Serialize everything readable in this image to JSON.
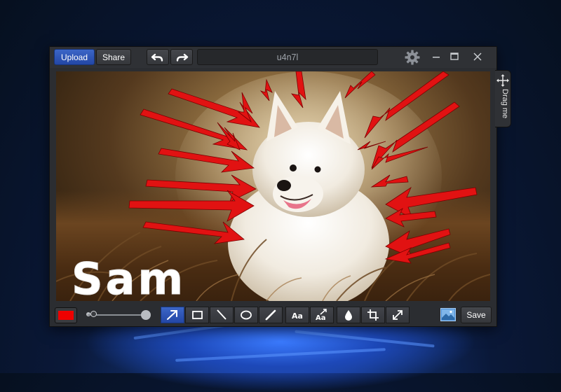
{
  "titlebar": {
    "upload_label": "Upload",
    "share_label": "Share",
    "title_value": "u4n7l"
  },
  "drag_tab": {
    "label": "Drag me"
  },
  "toolbar": {
    "current_color": "#ee0000",
    "save_label": "Save",
    "active_tool": "arrow-tool"
  },
  "canvas": {
    "annotation_text": "Sam",
    "arrow_color": "#e11212"
  },
  "icons": [
    "undo-icon",
    "redo-icon",
    "gear-icon",
    "minimize-icon",
    "maximize-icon",
    "close-icon",
    "move-icon",
    "arrow-tool-icon",
    "rectangle-tool-icon",
    "line-tool-icon",
    "ellipse-tool-icon",
    "pen-tool-icon",
    "text-tool-icon",
    "text-arrow-tool-icon",
    "blur-tool-icon",
    "crop-tool-icon",
    "resize-tool-icon",
    "image-icon"
  ]
}
